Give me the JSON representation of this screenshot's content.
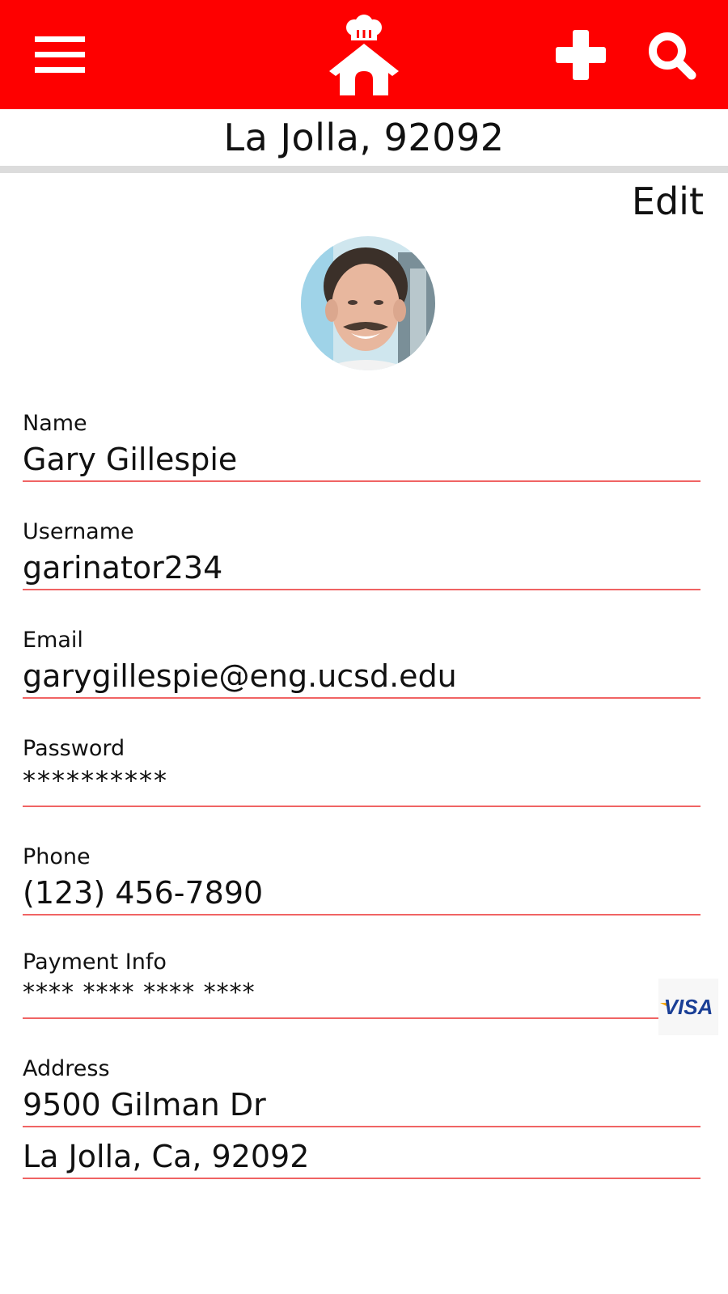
{
  "location": "La Jolla, 92092",
  "edit_label": "Edit",
  "icons": {
    "menu": "hamburger-menu-icon",
    "home": "chef-house-icon",
    "add": "plus-icon",
    "search": "search-icon",
    "card": "visa-logo"
  },
  "colors": {
    "brand_red": "#fe0000",
    "underline_red": "#f06464"
  },
  "profile": {
    "name_label": "Name",
    "name_value": "Gary Gillespie",
    "username_label": "Username",
    "username_value": "garinator234",
    "email_label": "Email",
    "email_value": "garygillespie@eng.ucsd.edu",
    "password_label": "Password",
    "password_value": "**********",
    "phone_label": "Phone",
    "phone_value": "(123) 456-7890",
    "payment_label": "Payment Info",
    "payment_value": "**** **** **** ****",
    "payment_card_brand": "VISA",
    "address_label": "Address",
    "address_line1": "9500 Gilman Dr",
    "address_line2": "La Jolla, Ca, 92092"
  }
}
